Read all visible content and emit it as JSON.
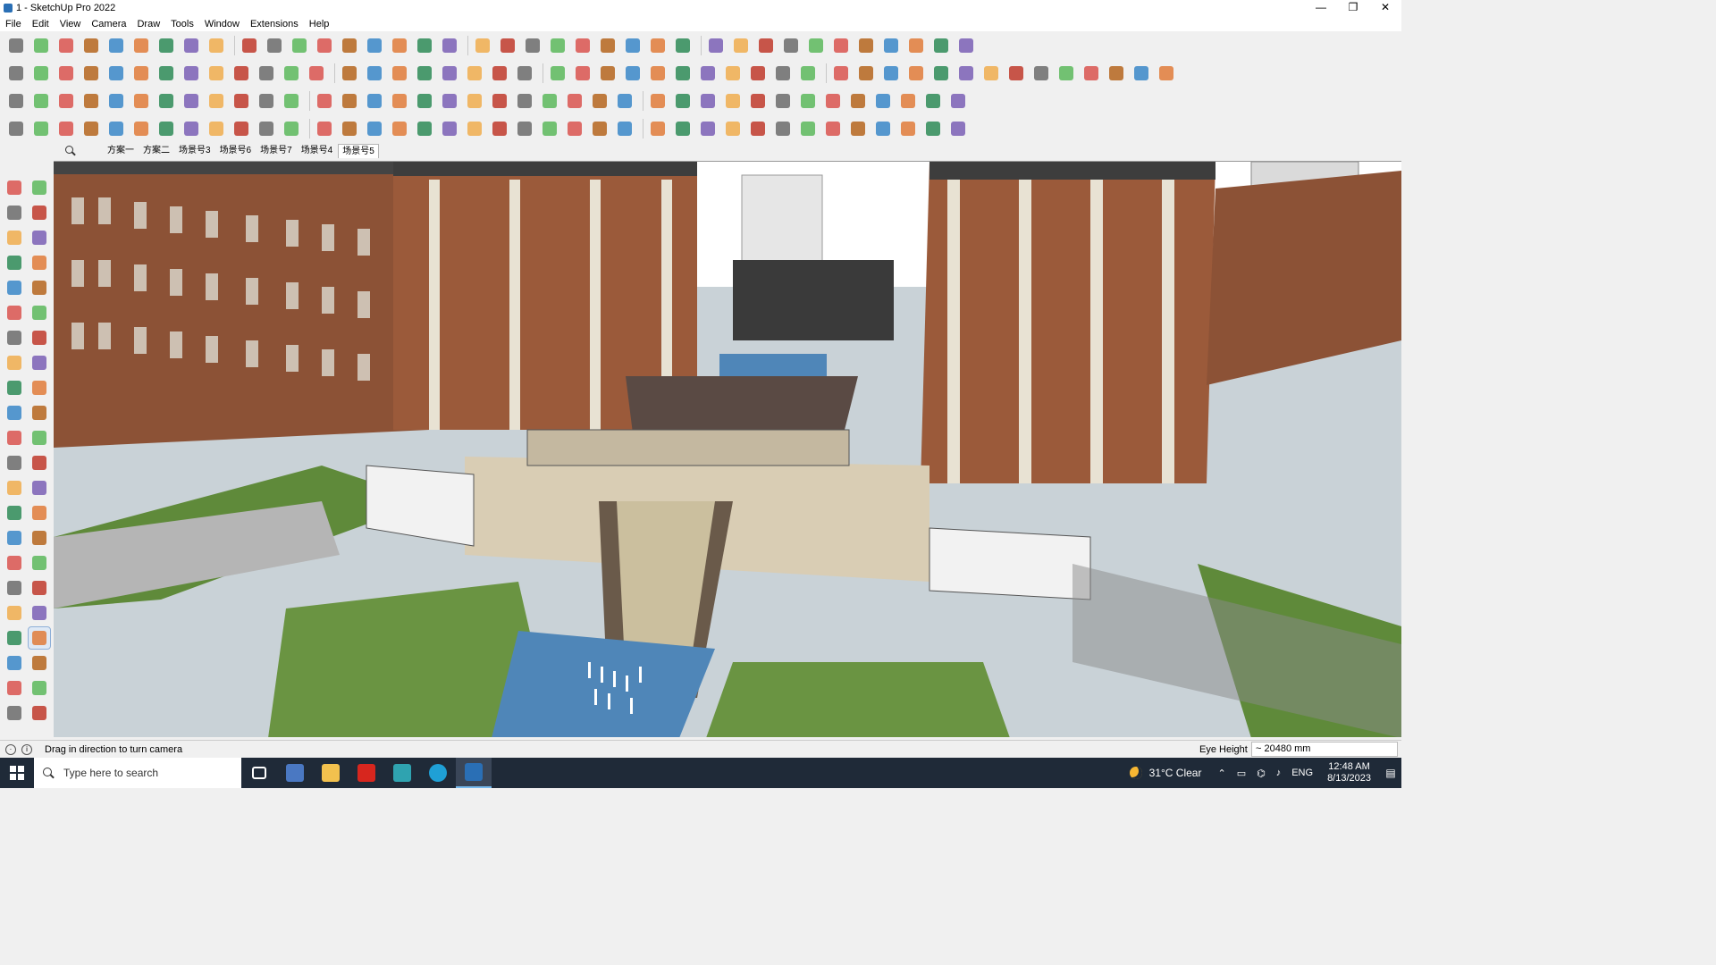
{
  "window": {
    "title": "1 - SketchUp Pro 2022"
  },
  "menu": [
    "File",
    "Edit",
    "View",
    "Camera",
    "Draw",
    "Tools",
    "Window",
    "Extensions",
    "Help"
  ],
  "scenes": {
    "tabs": [
      "方案一",
      "方案二",
      "场景号3",
      "场景号6",
      "场景号7",
      "场景号4",
      "场景号5"
    ],
    "active_index": 6
  },
  "status": {
    "message": "Drag in direction to turn camera",
    "vcb_label": "Eye Height",
    "vcb_value": "~ 20480 mm"
  },
  "taskbar": {
    "search_placeholder": "Type here to search",
    "weather": "31°C  Clear",
    "language": "ENG",
    "time": "12:48 AM",
    "date": "8/13/2023"
  },
  "colors": {
    "taskbar_bg": "#1f2a38",
    "sky": "#ffffff",
    "brick": "#9b5a3a",
    "lawn": "#5f8a3a",
    "water": "#4f86b8",
    "paving": "#c7d1d6"
  }
}
